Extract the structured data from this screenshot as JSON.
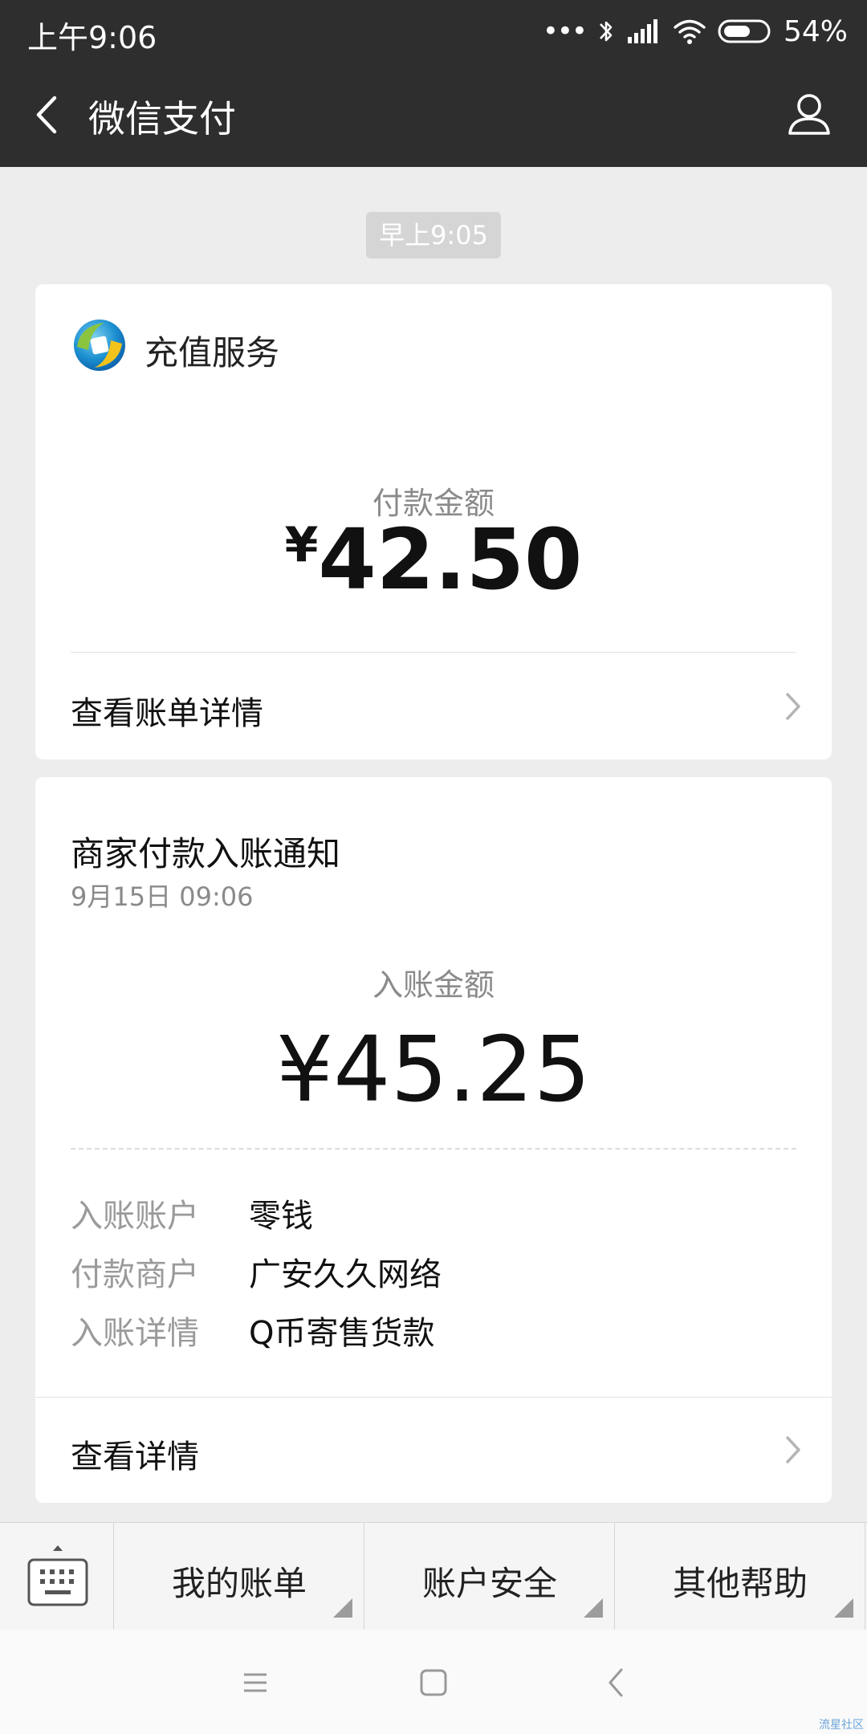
{
  "status_bar": {
    "time": "上午9:06",
    "signal_dots": "•••",
    "battery": "54%",
    "icons": [
      "bluetooth-icon",
      "signal-icon",
      "wifi-icon",
      "battery-icon"
    ]
  },
  "header": {
    "title": "微信支付",
    "back_icon": "back-icon",
    "profile_icon": "profile-icon"
  },
  "timestamp": "早上9:05",
  "recharge_card": {
    "service_name": "充值服务",
    "amount_label": "付款金额",
    "currency": "¥",
    "amount": "42.50",
    "link_label": "查看账单详情"
  },
  "receipt_card": {
    "title": "商家付款入账通知",
    "date": "9月15日  09:06",
    "amount_label": "入账金额",
    "amount": "¥45.25",
    "details": [
      {
        "label": "入账账户",
        "value": "零钱"
      },
      {
        "label": "付款商户",
        "value": "广安久久网络"
      },
      {
        "label": "入账详情",
        "value": "Q币寄售货款"
      }
    ],
    "link_label": "查看详情"
  },
  "bottom_menu": {
    "items": [
      "我的账单",
      "账户安全",
      "其他帮助"
    ]
  },
  "watermark": "流星社区",
  "colors": {
    "header_bg": "#2e2e2e",
    "page_bg": "#ededed",
    "card_bg": "#ffffff",
    "muted_text": "#8a8a8a"
  }
}
